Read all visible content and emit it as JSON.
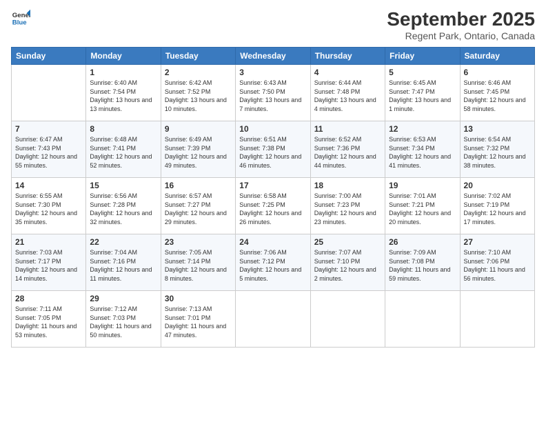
{
  "logo": {
    "line1": "General",
    "line2": "Blue"
  },
  "header": {
    "title": "September 2025",
    "subtitle": "Regent Park, Ontario, Canada"
  },
  "weekdays": [
    "Sunday",
    "Monday",
    "Tuesday",
    "Wednesday",
    "Thursday",
    "Friday",
    "Saturday"
  ],
  "weeks": [
    [
      {
        "day": "",
        "info": ""
      },
      {
        "day": "1",
        "info": "Sunrise: 6:40 AM\nSunset: 7:54 PM\nDaylight: 13 hours and 13 minutes."
      },
      {
        "day": "2",
        "info": "Sunrise: 6:42 AM\nSunset: 7:52 PM\nDaylight: 13 hours and 10 minutes."
      },
      {
        "day": "3",
        "info": "Sunrise: 6:43 AM\nSunset: 7:50 PM\nDaylight: 13 hours and 7 minutes."
      },
      {
        "day": "4",
        "info": "Sunrise: 6:44 AM\nSunset: 7:48 PM\nDaylight: 13 hours and 4 minutes."
      },
      {
        "day": "5",
        "info": "Sunrise: 6:45 AM\nSunset: 7:47 PM\nDaylight: 13 hours and 1 minute."
      },
      {
        "day": "6",
        "info": "Sunrise: 6:46 AM\nSunset: 7:45 PM\nDaylight: 12 hours and 58 minutes."
      }
    ],
    [
      {
        "day": "7",
        "info": "Sunrise: 6:47 AM\nSunset: 7:43 PM\nDaylight: 12 hours and 55 minutes."
      },
      {
        "day": "8",
        "info": "Sunrise: 6:48 AM\nSunset: 7:41 PM\nDaylight: 12 hours and 52 minutes."
      },
      {
        "day": "9",
        "info": "Sunrise: 6:49 AM\nSunset: 7:39 PM\nDaylight: 12 hours and 49 minutes."
      },
      {
        "day": "10",
        "info": "Sunrise: 6:51 AM\nSunset: 7:38 PM\nDaylight: 12 hours and 46 minutes."
      },
      {
        "day": "11",
        "info": "Sunrise: 6:52 AM\nSunset: 7:36 PM\nDaylight: 12 hours and 44 minutes."
      },
      {
        "day": "12",
        "info": "Sunrise: 6:53 AM\nSunset: 7:34 PM\nDaylight: 12 hours and 41 minutes."
      },
      {
        "day": "13",
        "info": "Sunrise: 6:54 AM\nSunset: 7:32 PM\nDaylight: 12 hours and 38 minutes."
      }
    ],
    [
      {
        "day": "14",
        "info": "Sunrise: 6:55 AM\nSunset: 7:30 PM\nDaylight: 12 hours and 35 minutes."
      },
      {
        "day": "15",
        "info": "Sunrise: 6:56 AM\nSunset: 7:28 PM\nDaylight: 12 hours and 32 minutes."
      },
      {
        "day": "16",
        "info": "Sunrise: 6:57 AM\nSunset: 7:27 PM\nDaylight: 12 hours and 29 minutes."
      },
      {
        "day": "17",
        "info": "Sunrise: 6:58 AM\nSunset: 7:25 PM\nDaylight: 12 hours and 26 minutes."
      },
      {
        "day": "18",
        "info": "Sunrise: 7:00 AM\nSunset: 7:23 PM\nDaylight: 12 hours and 23 minutes."
      },
      {
        "day": "19",
        "info": "Sunrise: 7:01 AM\nSunset: 7:21 PM\nDaylight: 12 hours and 20 minutes."
      },
      {
        "day": "20",
        "info": "Sunrise: 7:02 AM\nSunset: 7:19 PM\nDaylight: 12 hours and 17 minutes."
      }
    ],
    [
      {
        "day": "21",
        "info": "Sunrise: 7:03 AM\nSunset: 7:17 PM\nDaylight: 12 hours and 14 minutes."
      },
      {
        "day": "22",
        "info": "Sunrise: 7:04 AM\nSunset: 7:16 PM\nDaylight: 12 hours and 11 minutes."
      },
      {
        "day": "23",
        "info": "Sunrise: 7:05 AM\nSunset: 7:14 PM\nDaylight: 12 hours and 8 minutes."
      },
      {
        "day": "24",
        "info": "Sunrise: 7:06 AM\nSunset: 7:12 PM\nDaylight: 12 hours and 5 minutes."
      },
      {
        "day": "25",
        "info": "Sunrise: 7:07 AM\nSunset: 7:10 PM\nDaylight: 12 hours and 2 minutes."
      },
      {
        "day": "26",
        "info": "Sunrise: 7:09 AM\nSunset: 7:08 PM\nDaylight: 11 hours and 59 minutes."
      },
      {
        "day": "27",
        "info": "Sunrise: 7:10 AM\nSunset: 7:06 PM\nDaylight: 11 hours and 56 minutes."
      }
    ],
    [
      {
        "day": "28",
        "info": "Sunrise: 7:11 AM\nSunset: 7:05 PM\nDaylight: 11 hours and 53 minutes."
      },
      {
        "day": "29",
        "info": "Sunrise: 7:12 AM\nSunset: 7:03 PM\nDaylight: 11 hours and 50 minutes."
      },
      {
        "day": "30",
        "info": "Sunrise: 7:13 AM\nSunset: 7:01 PM\nDaylight: 11 hours and 47 minutes."
      },
      {
        "day": "",
        "info": ""
      },
      {
        "day": "",
        "info": ""
      },
      {
        "day": "",
        "info": ""
      },
      {
        "day": "",
        "info": ""
      }
    ]
  ]
}
